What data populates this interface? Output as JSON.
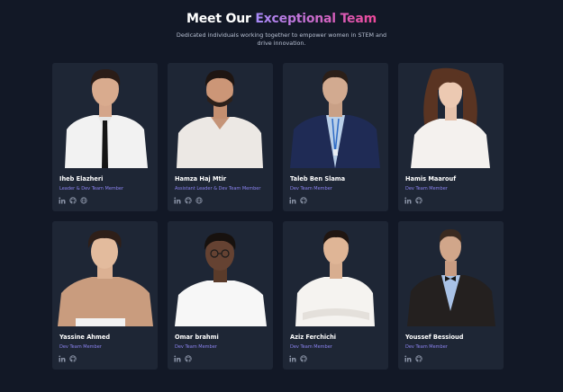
{
  "header": {
    "title_prefix": "Meet Our",
    "title_accent": "Exceptional Team",
    "subtitle": "Dedicated individuals working together to empower women in STEM and drive innovation."
  },
  "colors": {
    "background": "#121826",
    "card": "#1e2635",
    "accent_from": "#a78bfa",
    "accent_to": "#ec4899",
    "role_text": "#8b83f0"
  },
  "team": [
    {
      "name": "Iheb Elazheri",
      "role": "Leader & Dev Team Member",
      "links": [
        "linkedin-icon",
        "github-icon",
        "globe-icon"
      ]
    },
    {
      "name": "Hamza Haj Mtir",
      "role": "Assistant Leader & Dev Team Member",
      "links": [
        "linkedin-icon",
        "github-icon",
        "globe-icon"
      ]
    },
    {
      "name": "Taleb Ben Slama",
      "role": "Dev Team Member",
      "links": [
        "linkedin-icon",
        "github-icon"
      ]
    },
    {
      "name": "Hamis Maarouf",
      "role": "Dev Team Member",
      "links": [
        "linkedin-icon",
        "github-icon"
      ]
    },
    {
      "name": "Yassine Ahmed",
      "role": "Dev Team Member",
      "links": [
        "linkedin-icon",
        "github-icon"
      ]
    },
    {
      "name": "Omar brahmi",
      "role": "Dev Team Member",
      "links": [
        "linkedin-icon",
        "github-icon"
      ]
    },
    {
      "name": "Aziz Ferchichi",
      "role": "Dev Team Member",
      "links": [
        "linkedin-icon",
        "github-icon"
      ]
    },
    {
      "name": "Youssef Bessioud",
      "role": "Dev Team Member",
      "links": [
        "linkedin-icon",
        "github-icon"
      ]
    }
  ]
}
